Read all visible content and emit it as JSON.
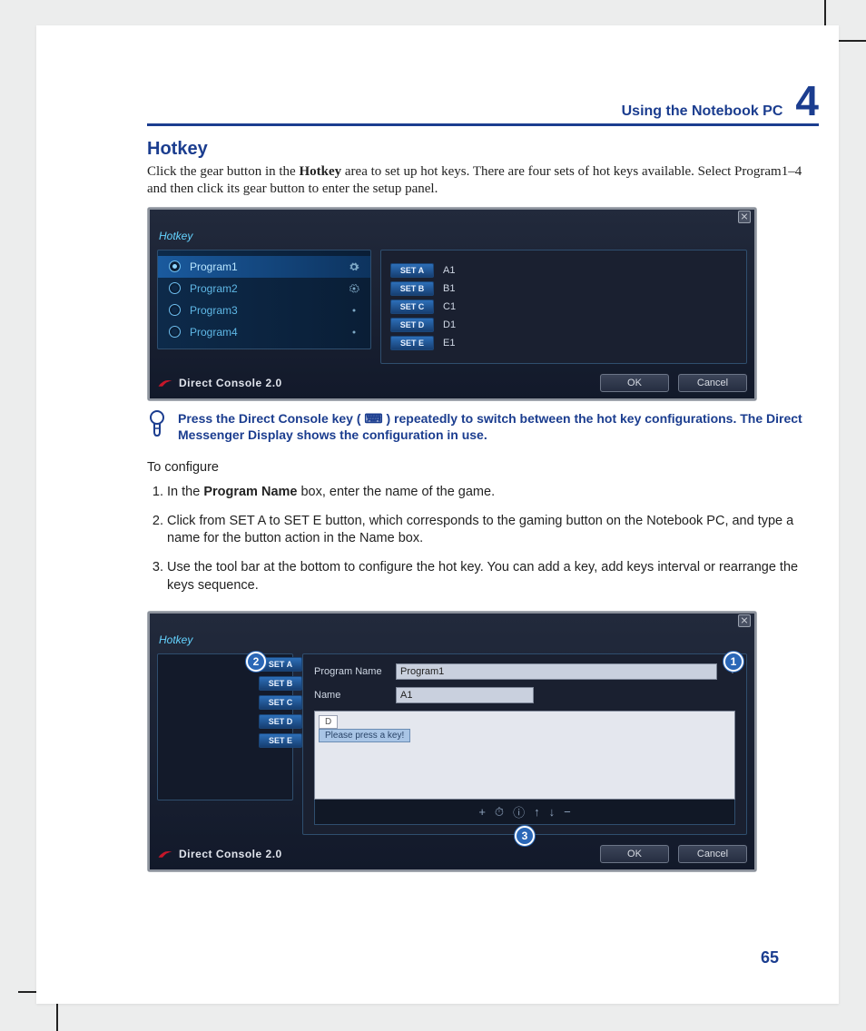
{
  "chapter": {
    "title": "Using the Notebook PC",
    "number": "4"
  },
  "section_title": "Hotkey",
  "intro_para": "Click the gear button in the Hotkey area to set up hot keys. There are four sets of hot keys available. Select Program1–4 and then click its gear button to enter the setup panel.",
  "tip_text": "Press the Direct Console key ( ⌨ ) repeatedly to switch between the hot key configurations. The Direct Messenger Display shows the configuration in use.",
  "steps_intro": "To configure",
  "steps": [
    "In the Program Name box, enter the name of the game.",
    "Click from SET A to SET E button, which corresponds to the gaming button on the Notebook PC, and type a name for the button action in the Name box.",
    "Use the tool bar at the bottom to configure the hot key. You can add a key, add keys interval or rearrange the keys sequence."
  ],
  "step_bold": {
    "program_name": "Program Name",
    "name": "Name"
  },
  "page_number": "65",
  "shot1": {
    "tab": "Hotkey",
    "programs": [
      "Program1",
      "Program2",
      "Program3",
      "Program4"
    ],
    "selected_program_index": 0,
    "sets": [
      {
        "label": "SET A",
        "value": "A1"
      },
      {
        "label": "SET B",
        "value": "B1"
      },
      {
        "label": "SET C",
        "value": "C1"
      },
      {
        "label": "SET D",
        "value": "D1"
      },
      {
        "label": "SET E",
        "value": "E1"
      }
    ],
    "brand": "Direct Console 2.0",
    "ok": "OK",
    "cancel": "Cancel"
  },
  "shot2": {
    "tab": "Hotkey",
    "program_name_label": "Program Name",
    "program_name_value": "Program1",
    "name_label": "Name",
    "name_value": "A1",
    "key_cell": "D",
    "key_placeholder": "Please press a key!",
    "sets": [
      "SET A",
      "SET B",
      "SET C",
      "SET D",
      "SET E"
    ],
    "toolbar_icons": [
      "+",
      "⏱",
      "ⓘ",
      "↑",
      "↓",
      "−"
    ],
    "brand": "Direct Console 2.0",
    "ok": "OK",
    "cancel": "Cancel",
    "callouts": {
      "one": "1",
      "two": "2",
      "three": "3"
    }
  }
}
